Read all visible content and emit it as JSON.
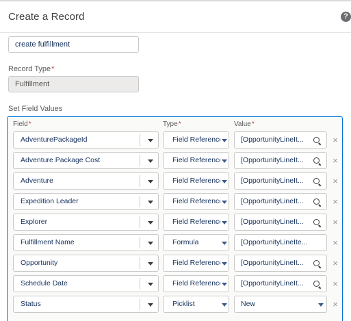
{
  "header": {
    "title": "Create a Record",
    "help_icon": "question-circle-icon",
    "help_glyph": "?"
  },
  "form": {
    "name_value": "create fulfillment",
    "record_type_label": "Record Type",
    "record_type_value": "Fulfillment",
    "required_marker": "*",
    "set_field_values_label": "Set Field Values"
  },
  "columns": {
    "field": "Field",
    "type": "Type",
    "value": "Value"
  },
  "rows": [
    {
      "field": "AdventurePackageId",
      "type": "Field Reference",
      "value": "[OpportunityLineIt...",
      "value_icon": "search-icon"
    },
    {
      "field": "Adventure Package Cost",
      "type": "Field Reference",
      "value": "[OpportunityLineIt...",
      "value_icon": "search-icon"
    },
    {
      "field": "Adventure",
      "type": "Field Reference",
      "value": "[OpportunityLineIt...",
      "value_icon": "search-icon"
    },
    {
      "field": "Expedition Leader",
      "type": "Field Reference",
      "value": "[OpportunityLineIt...",
      "value_icon": "search-icon"
    },
    {
      "field": "Explorer",
      "type": "Field Reference",
      "value": "[OpportunityLineIt...",
      "value_icon": "search-icon"
    },
    {
      "field": "Fulfillment Name",
      "type": "Formula",
      "value": "[OpportunityLineIte...",
      "value_icon": "none"
    },
    {
      "field": "Opportunity",
      "type": "Field Reference",
      "value": "[OpportunityLineIt...",
      "value_icon": "search-icon"
    },
    {
      "field": "Schedule Date",
      "type": "Field Reference",
      "value": "[OpportunityLineIt...",
      "value_icon": "search-icon"
    },
    {
      "field": "Status",
      "type": "Picklist",
      "value": "New",
      "value_icon": "chevron-down-icon"
    }
  ],
  "remove_glyph": "×",
  "colors": {
    "accent": "#0070d2",
    "required": "#c23934",
    "text": "#16325c"
  }
}
